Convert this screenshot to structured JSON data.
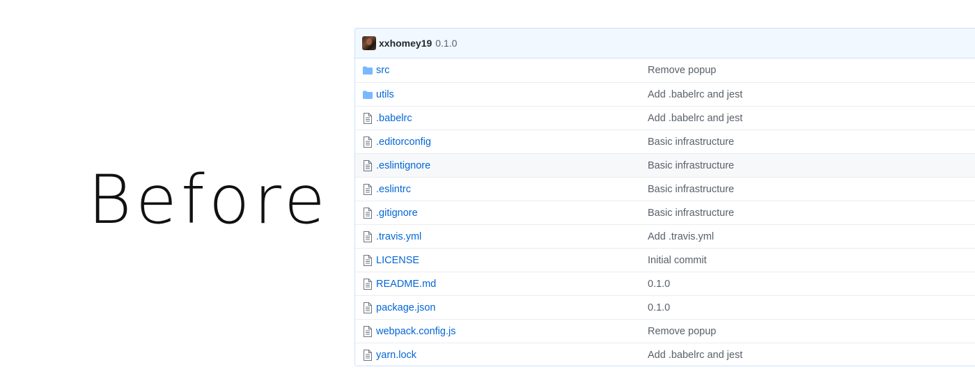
{
  "heading": "Before",
  "commit": {
    "author": "xxhomey19",
    "message": "0.1.0"
  },
  "files": [
    {
      "name": "src",
      "type": "folder",
      "message": "Remove popup"
    },
    {
      "name": "utils",
      "type": "folder",
      "message": "Add .babelrc and jest"
    },
    {
      "name": ".babelrc",
      "type": "file",
      "message": "Add .babelrc and jest"
    },
    {
      "name": ".editorconfig",
      "type": "file",
      "message": "Basic infrastructure"
    },
    {
      "name": ".eslintignore",
      "type": "file",
      "message": "Basic infrastructure"
    },
    {
      "name": ".eslintrc",
      "type": "file",
      "message": "Basic infrastructure"
    },
    {
      "name": ".gitignore",
      "type": "file",
      "message": "Basic infrastructure"
    },
    {
      "name": ".travis.yml",
      "type": "file",
      "message": "Add .travis.yml"
    },
    {
      "name": "LICENSE",
      "type": "file",
      "message": "Initial commit"
    },
    {
      "name": "README.md",
      "type": "file",
      "message": "0.1.0"
    },
    {
      "name": "package.json",
      "type": "file",
      "message": "0.1.0"
    },
    {
      "name": "webpack.config.js",
      "type": "file",
      "message": "Remove popup"
    },
    {
      "name": "yarn.lock",
      "type": "file",
      "message": "Add .babelrc and jest"
    }
  ],
  "colors": {
    "link": "#0366d6",
    "folder_icon": "#79b8ff",
    "file_icon": "#6a737d",
    "header_bg": "#f1f8ff",
    "border": "#c8e1ff"
  },
  "icons": {
    "folder": "folder-icon",
    "file": "file-icon"
  }
}
